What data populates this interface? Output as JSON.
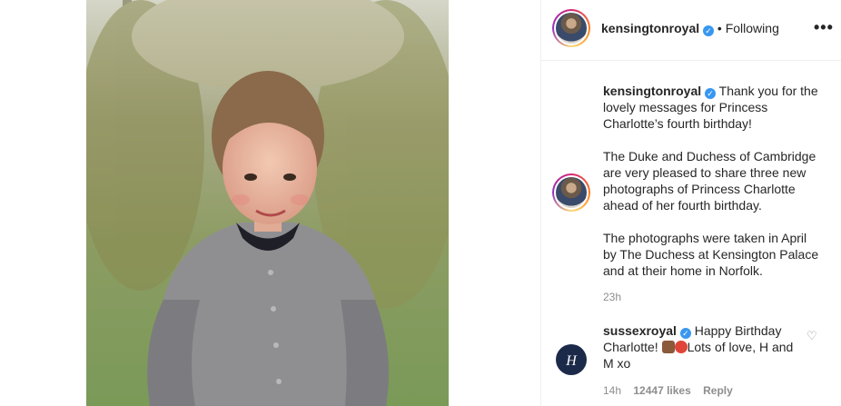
{
  "post": {
    "author": "kensingtonroyal",
    "verified_mark": "✓",
    "follow_status": "• Following",
    "more_icon": "•••",
    "caption_paragraphs": [
      "Thank you for the lovely messages for Princess Charlotte’s fourth birthday!",
      "The Duke and Duchess of Cambridge are very pleased to share three new photographs of Princess Charlotte ahead of her fourth birthday.",
      "The photographs were taken in April by The Duchess at Kensington Palace and at their home in Norfolk."
    ],
    "time_ago": "23h"
  },
  "comment": {
    "author": "sussexroyal",
    "text_start": "Happy Birthday Charlotte! ",
    "text_end": "Lots of love, H and M xo",
    "emojis": [
      "cake-emoji",
      "balloon-emoji"
    ],
    "avatar_monogram": "H",
    "time_ago": "14h",
    "likes": "12447 likes",
    "reply_label": "Reply"
  },
  "colors": {
    "verified": "#3897f0",
    "meta_gray": "#8e8e8e",
    "text": "#262626"
  }
}
